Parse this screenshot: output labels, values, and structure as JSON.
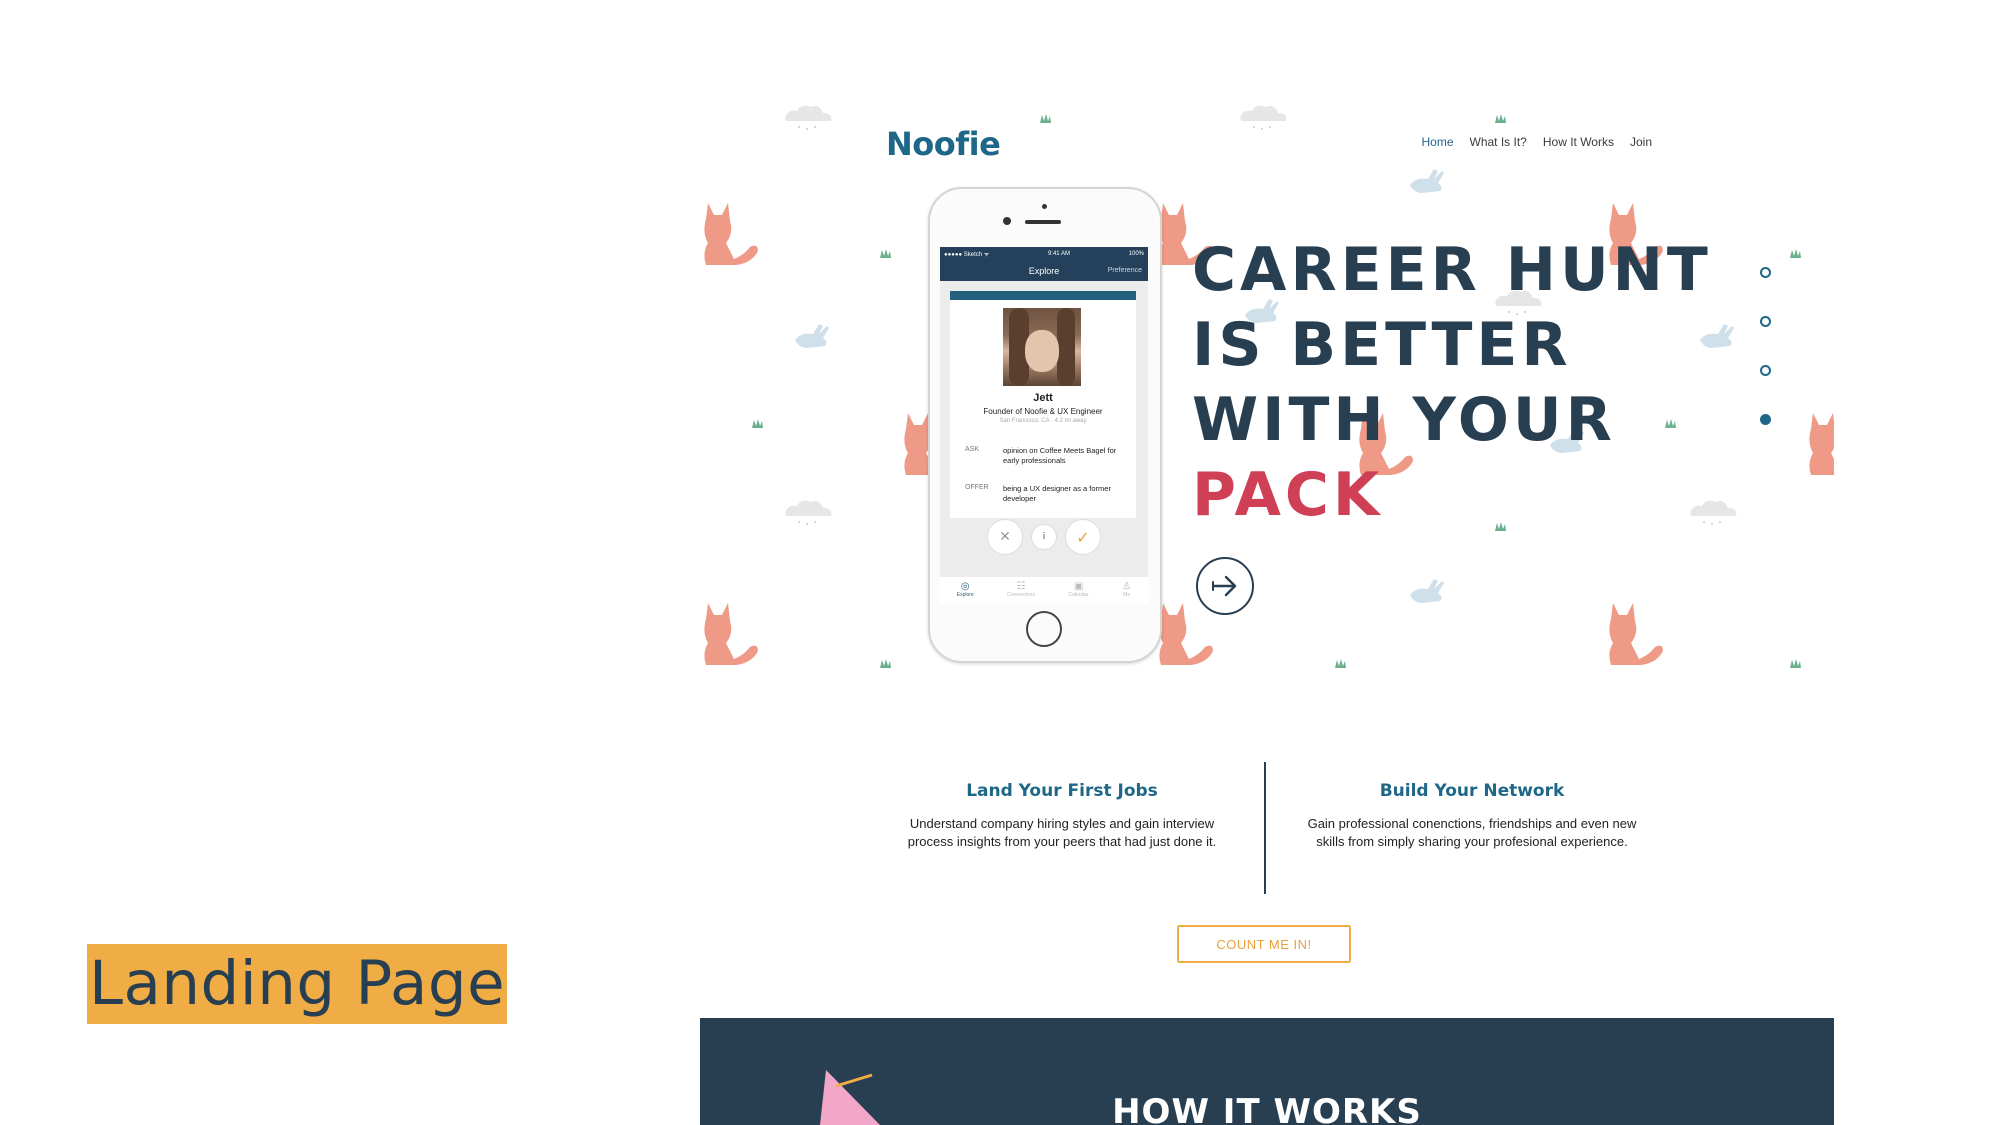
{
  "slide": {
    "label": "Landing Page"
  },
  "site": {
    "logo": "Noofie",
    "nav": [
      "Home",
      "What Is It?",
      "How It Works",
      "Join"
    ],
    "nav_active": "Home"
  },
  "hero": {
    "lines": [
      "CAREER HUNT",
      "IS BETTER",
      "WITH YOUR"
    ],
    "accent_line": "PACK",
    "slider_dots": {
      "count": 4,
      "active_index": 3
    }
  },
  "phone": {
    "status": {
      "carrier": "●●●●● Sketch ᯤ",
      "time": "9:41 AM",
      "battery": "100%"
    },
    "appbar": {
      "title": "Explore",
      "preference": "Preference"
    },
    "profile": {
      "name": "Jett",
      "role": "Founder of Noofie & UX Engineer",
      "location": "San Francisco, CA · 4.2 mi away",
      "ask_label": "ASK",
      "ask_text": "opinion on Coffee Meets Bagel for early professionals",
      "offer_label": "OFFER",
      "offer_text": "being a UX designer as a former developer"
    },
    "actions": {
      "reject": "✕",
      "info": "i",
      "accept": "✓"
    },
    "tabs": [
      "Explore",
      "Connections",
      "Calendar",
      "Me"
    ]
  },
  "features": [
    {
      "title": "Land Your First Jobs",
      "text": "Understand company hiring styles and gain interview process insights from your peers that had just done it."
    },
    {
      "title": "Build Your Network",
      "text": "Gain professional conenctions, friendships and even new skills from simply sharing your profesional experience."
    }
  ],
  "cta": {
    "label": "COUNT ME IN!"
  },
  "how": {
    "title": "HOW IT WORKS"
  },
  "colors": {
    "brand": "#1f6788",
    "navy": "#283e51",
    "accent": "#cf3f55",
    "orange": "#f0ad45",
    "fox": "#ef9a86"
  }
}
